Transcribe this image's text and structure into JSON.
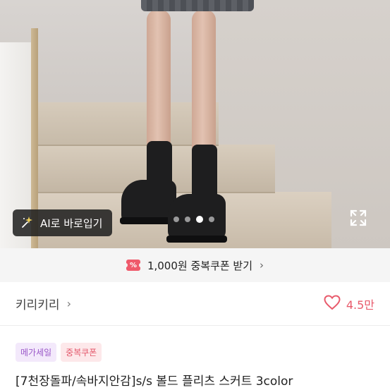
{
  "photo": {
    "ai_button_label": "AI로 바로입기",
    "carousel": {
      "total": 4,
      "active_index": 2
    }
  },
  "coupon": {
    "icon_text": "%",
    "text": "1,000원 중복쿠폰 받기",
    "chevron": "›"
  },
  "seller": {
    "name": "키리키리",
    "chevron": "›",
    "likes": "4.5만"
  },
  "product": {
    "badges": [
      "메가세일",
      "중복쿠폰"
    ],
    "title": "[7천장돌파/속바지안감]s/s 볼드 플리츠 스커트 3color"
  },
  "colors": {
    "accent": "#e85a6b",
    "mega_badge": "#9b59c9",
    "coupon_bar": "#f5f5f5"
  }
}
